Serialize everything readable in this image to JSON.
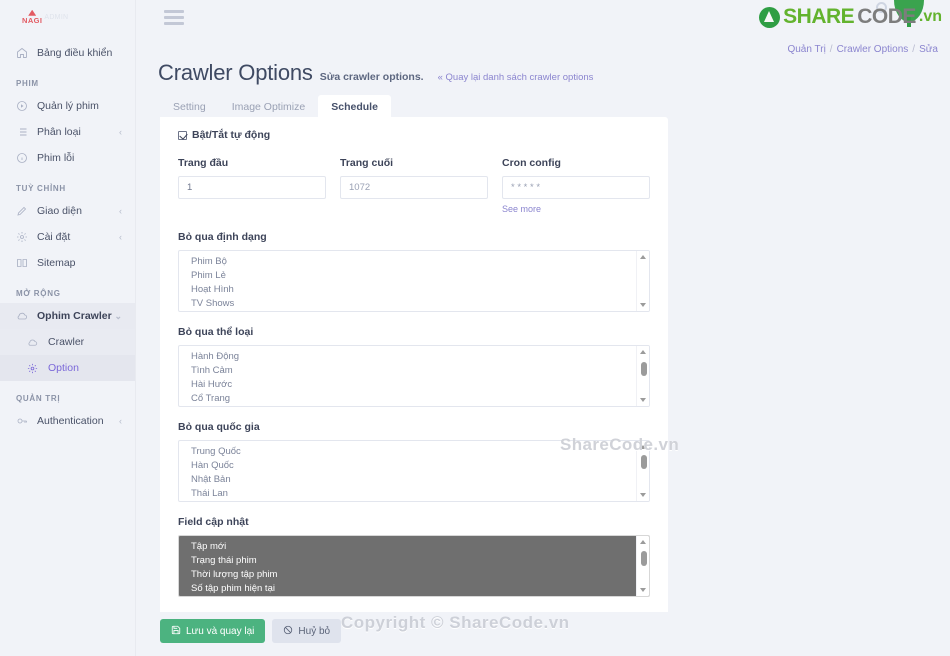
{
  "brand": {
    "logo_text": "NAGI",
    "logo_sub": "ADMIN"
  },
  "topbar": {
    "menu_icon": "hamburger-icon",
    "watermark_share": "SHARE",
    "watermark_code": "CODE",
    "watermark_vn": ".vn"
  },
  "breadcrumb": {
    "items": [
      "Quản Trị",
      "Crawler Options",
      "Sửa"
    ],
    "separator": "/"
  },
  "sidebar": {
    "items": [
      {
        "label": "Bảng điều khiển",
        "icon": "home-icon",
        "type": "item",
        "caret": ""
      },
      {
        "label": "PHIM",
        "type": "section"
      },
      {
        "label": "Quản lý phim",
        "icon": "play-circle-icon",
        "type": "item",
        "caret": ""
      },
      {
        "label": "Phân loại",
        "icon": "list-icon",
        "type": "item",
        "caret": "‹"
      },
      {
        "label": "Phim lỗi",
        "icon": "info-circle-icon",
        "type": "item",
        "caret": ""
      },
      {
        "label": "TUỲ CHỈNH",
        "type": "section"
      },
      {
        "label": "Giao diện",
        "icon": "pencil-icon",
        "type": "item",
        "caret": "‹"
      },
      {
        "label": "Cài đặt",
        "icon": "gear-icon",
        "type": "item",
        "caret": "‹"
      },
      {
        "label": "Sitemap",
        "icon": "book-icon",
        "type": "item",
        "caret": ""
      },
      {
        "label": "MỞ RỘNG",
        "type": "section"
      },
      {
        "label": "Ophim Crawler",
        "icon": "cloud-icon",
        "type": "parent",
        "caret": "⌄"
      },
      {
        "label": "Crawler",
        "icon": "cloud-icon",
        "type": "sub",
        "caret": ""
      },
      {
        "label": "Option",
        "icon": "gear-icon",
        "type": "sub-active",
        "caret": ""
      },
      {
        "label": "QUẢN TRỊ",
        "type": "section"
      },
      {
        "label": "Authentication",
        "icon": "key-icon",
        "type": "item",
        "caret": "‹"
      }
    ]
  },
  "page": {
    "title": "Crawler Options",
    "subtitle": "Sửa crawler options.",
    "back_link": "« Quay lại danh sách crawler options"
  },
  "tabs": [
    {
      "label": "Setting",
      "active": false
    },
    {
      "label": "Image Optimize",
      "active": false
    },
    {
      "label": "Schedule",
      "active": true
    }
  ],
  "form": {
    "auto_toggle_label": "Bật/Tắt tự động",
    "auto_toggle_checked": true,
    "fields": [
      {
        "label": "Trang đầu",
        "value": "1",
        "placeholder": ""
      },
      {
        "label": "Trang cuối",
        "value": "",
        "placeholder": "1072"
      },
      {
        "label": "Cron config",
        "value": "",
        "placeholder": "* * * * *"
      }
    ],
    "see_more": "See more",
    "lists": [
      {
        "label": "Bỏ qua định dạng",
        "options": [
          "Phim Bộ",
          "Phim Lẻ",
          "Hoạt Hình",
          "TV Shows"
        ],
        "selected": false,
        "thumb": false
      },
      {
        "label": "Bỏ qua thể loại",
        "options": [
          "Hành Động",
          "Tình Cảm",
          "Hài Hước",
          "Cổ Trang"
        ],
        "selected": false,
        "thumb": true
      },
      {
        "label": "Bỏ qua quốc gia",
        "options": [
          "Trung Quốc",
          "Hàn Quốc",
          "Nhật Bản",
          "Thái Lan"
        ],
        "selected": false,
        "thumb": true
      },
      {
        "label": "Field cập nhật",
        "options": [
          "Tập mới",
          "Trạng thái phim",
          "Thời lượng tập phim",
          "Số tập phim hiện tại"
        ],
        "selected": true,
        "thumb": true
      }
    ]
  },
  "footer": {
    "save_label": "Lưu và quay lại",
    "save_icon": "save-icon",
    "cancel_label": "Huỷ bỏ",
    "cancel_icon": "ban-icon"
  },
  "watermarks": {
    "center": "ShareCode.vn",
    "bottom": "Copyright © ShareCode.vn"
  },
  "colors": {
    "accent_purple": "#7b68d9",
    "primary_green": "#4cb380",
    "brand_red": "#e35b63",
    "sidebar_bg": "#f1f3f8",
    "page_bg": "#f1f3f8"
  }
}
